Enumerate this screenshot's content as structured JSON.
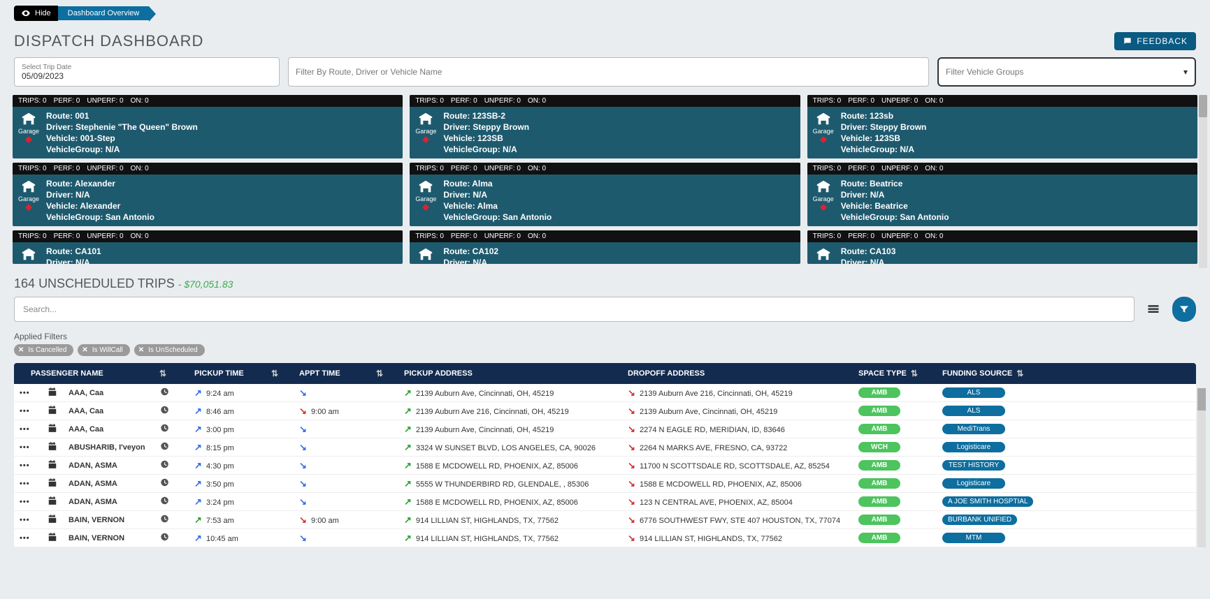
{
  "top": {
    "hide": "Hide",
    "crumb": "Dashboard Overview"
  },
  "title": "DISPATCH DASHBOARD",
  "feedback": "FEEDBACK",
  "filters": {
    "dateLabel": "Select Trip Date",
    "dateValue": "05/09/2023",
    "searchPh": "Filter By Route, Driver or Vehicle Name",
    "groupPh": "Filter Vehicle Groups"
  },
  "statsTemplate": {
    "trips": "TRIPS: 0",
    "perf": "PERF: 0",
    "unperf": "UNPERF: 0",
    "on": "ON: 0"
  },
  "garageLabel": "Garage",
  "cards": [
    [
      {
        "route": "Route: 001",
        "driver": "Driver: Stephenie \"The Queen\" Brown",
        "vehicle": "Vehicle: 001-Step",
        "group": "VehicleGroup: N/A"
      },
      {
        "route": "Route: Alexander",
        "driver": "Driver: N/A",
        "vehicle": "Vehicle: Alexander",
        "group": "VehicleGroup: San Antonio"
      },
      {
        "route": "Route: CA101",
        "driver": "Driver: N/A",
        "cut": true
      }
    ],
    [
      {
        "route": "Route: 123SB-2",
        "driver": "Driver: Steppy Brown",
        "vehicle": "Vehicle: 123SB",
        "group": "VehicleGroup: N/A"
      },
      {
        "route": "Route: Alma",
        "driver": "Driver: N/A",
        "vehicle": "Vehicle: Alma",
        "group": "VehicleGroup: San Antonio"
      },
      {
        "route": "Route: CA102",
        "driver": "Driver: N/A",
        "cut": true
      }
    ],
    [
      {
        "route": "Route: 123sb",
        "driver": "Driver: Steppy Brown",
        "vehicle": "Vehicle: 123SB",
        "group": "VehicleGroup: N/A"
      },
      {
        "route": "Route: Beatrice",
        "driver": "Driver: N/A",
        "vehicle": "Vehicle: Beatrice",
        "group": "VehicleGroup: San Antonio"
      },
      {
        "route": "Route: CA103",
        "driver": "Driver: N/A",
        "cut": true
      }
    ]
  ],
  "unscheduled": {
    "count": "164",
    "label": "UNSCHEDULED TRIPS",
    "amount": "$70,051.83",
    "sep": " - "
  },
  "searchPh": "Search...",
  "appliedLabel": "Applied Filters",
  "appliedPills": [
    "Is Cancelled",
    "Is WillCall",
    "Is UnScheduled"
  ],
  "columns": {
    "passenger": "PASSENGER NAME",
    "pickup": "PICKUP TIME",
    "appt": "APPT TIME",
    "paddr": "PICKUP ADDRESS",
    "daddr": "DROPOFF ADDRESS",
    "space": "SPACE TYPE",
    "fund": "FUNDING SOURCE"
  },
  "rows": [
    {
      "name": "AAA, Caa",
      "ptime": "9:24 am",
      "pdir": "ne",
      "appt": "",
      "adir": "se",
      "paddr": "2139 Auburn Ave, Cincinnati, OH, 45219",
      "daddr": "2139 Auburn Ave 216, Cincinnati, OH, 45219",
      "space": "AMB",
      "fund": "ALS"
    },
    {
      "name": "AAA, Caa",
      "ptime": "8:46 am",
      "pdir": "ne",
      "appt": "9:00 am",
      "adir": "do",
      "paddr": "2139 Auburn Ave 216, Cincinnati, OH, 45219",
      "daddr": "2139 Auburn Ave, Cincinnati, OH, 45219",
      "space": "AMB",
      "fund": "ALS"
    },
    {
      "name": "AAA, Caa",
      "ptime": "3:00 pm",
      "pdir": "ne",
      "appt": "",
      "adir": "se",
      "paddr": "2139 Auburn Ave, Cincinnati, OH, 45219",
      "daddr": "2274 N EAGLE RD, MERIDIAN, ID, 83646",
      "space": "AMB",
      "fund": "MediTrans"
    },
    {
      "name": "ABUSHARIB, I'veyon",
      "ptime": "8:15 pm",
      "pdir": "ne",
      "appt": "",
      "adir": "se",
      "paddr": "3324 W SUNSET BLVD, LOS ANGELES, CA, 90026",
      "daddr": "2264 N MARKS AVE, FRESNO, CA, 93722",
      "space": "WCH",
      "fund": "Logisticare"
    },
    {
      "name": "ADAN, ASMA",
      "ptime": "4:30 pm",
      "pdir": "ne",
      "appt": "",
      "adir": "se",
      "paddr": "1588 E MCDOWELL RD, PHOENIX, AZ, 85006",
      "daddr": "11700 N SCOTTSDALE RD, SCOTTSDALE, AZ, 85254",
      "space": "AMB",
      "fund": "TEST HISTORY"
    },
    {
      "name": "ADAN, ASMA",
      "ptime": "3:50 pm",
      "pdir": "ne",
      "appt": "",
      "adir": "se",
      "paddr": "5555 W THUNDERBIRD RD, GLENDALE, , 85306",
      "daddr": "1588 E MCDOWELL RD, PHOENIX, AZ, 85006",
      "space": "AMB",
      "fund": "Logisticare"
    },
    {
      "name": "ADAN, ASMA",
      "ptime": "3:24 pm",
      "pdir": "ne",
      "appt": "",
      "adir": "se",
      "paddr": "1588 E MCDOWELL RD, PHOENIX, AZ, 85006",
      "daddr": "123 N CENTRAL AVE, PHOENIX, AZ, 85004",
      "space": "AMB",
      "fund": "A JOE SMITH HOSPTIAL"
    },
    {
      "name": "BAIN, VERNON",
      "ptime": "7:53 am",
      "pdir": "pu",
      "appt": "9:00 am",
      "adir": "do",
      "paddr": "914 LILLIAN ST, HIGHLANDS, TX, 77562",
      "daddr": "6776 SOUTHWEST FWY, STE 407 HOUSTON, TX, 77074",
      "space": "AMB",
      "fund": "BURBANK UNIFIED"
    },
    {
      "name": "BAIN, VERNON",
      "ptime": "10:45 am",
      "pdir": "ne",
      "appt": "",
      "adir": "se",
      "paddr": "914 LILLIAN ST, HIGHLANDS, TX, 77562",
      "daddr": "914 LILLIAN ST, HIGHLANDS, TX, 77562",
      "space": "AMB",
      "fund": "MTM"
    }
  ]
}
